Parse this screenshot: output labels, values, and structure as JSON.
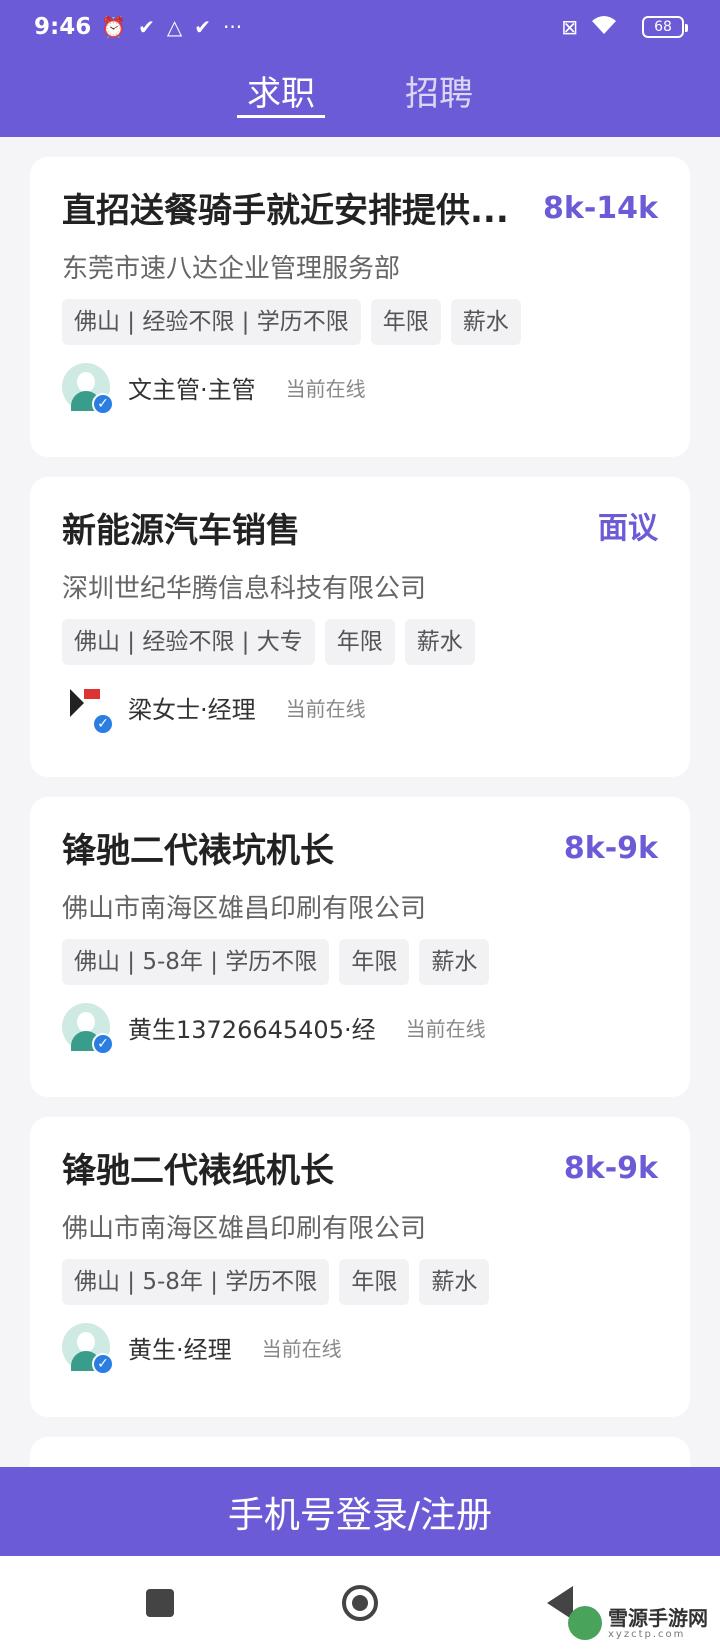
{
  "status_bar": {
    "time": "9:46",
    "icons": [
      "alarm-off-icon",
      "check-icon",
      "drive-icon",
      "check-icon",
      "more-icon"
    ],
    "more": "···",
    "battery": "68"
  },
  "tabs": [
    {
      "label": "求职",
      "active": true
    },
    {
      "label": "招聘",
      "active": false
    }
  ],
  "jobs": [
    {
      "title": "直招送餐骑手就近安排提供...",
      "salary": "8k-14k",
      "company": "东莞市速八达企业管理服务部",
      "tags": [
        "佛山 | 经验不限 | 学历不限",
        "年限",
        "薪水"
      ],
      "recruiter": "文主管·主管",
      "status": "当前在线",
      "avatar": "person"
    },
    {
      "title": "新能源汽车销售",
      "salary": "面议",
      "company": "深圳世纪华腾信息科技有限公司",
      "tags": [
        "佛山 | 经验不限 | 大专",
        "年限",
        "薪水"
      ],
      "recruiter": "梁女士·经理",
      "status": "当前在线",
      "avatar": "logo"
    },
    {
      "title": "锋驰二代裱坑机长",
      "salary": "8k-9k",
      "company": "佛山市南海区雄昌印刷有限公司",
      "tags": [
        "佛山 | 5-8年 | 学历不限",
        "年限",
        "薪水"
      ],
      "recruiter": "黄生13726645405·经",
      "status": "当前在线",
      "avatar": "person"
    },
    {
      "title": "锋驰二代裱纸机长",
      "salary": "8k-9k",
      "company": "佛山市南海区雄昌印刷有限公司",
      "tags": [
        "佛山 | 5-8年 | 学历不限",
        "年限",
        "薪水"
      ],
      "recruiter": "黄生·经理",
      "status": "当前在线",
      "avatar": "person"
    }
  ],
  "login_button": "手机号登录/注册",
  "watermark": {
    "name": "雪源手游网",
    "sub": "xyzctp.com"
  },
  "colors": {
    "accent": "#6b5bd6",
    "verified": "#2a7de1"
  }
}
